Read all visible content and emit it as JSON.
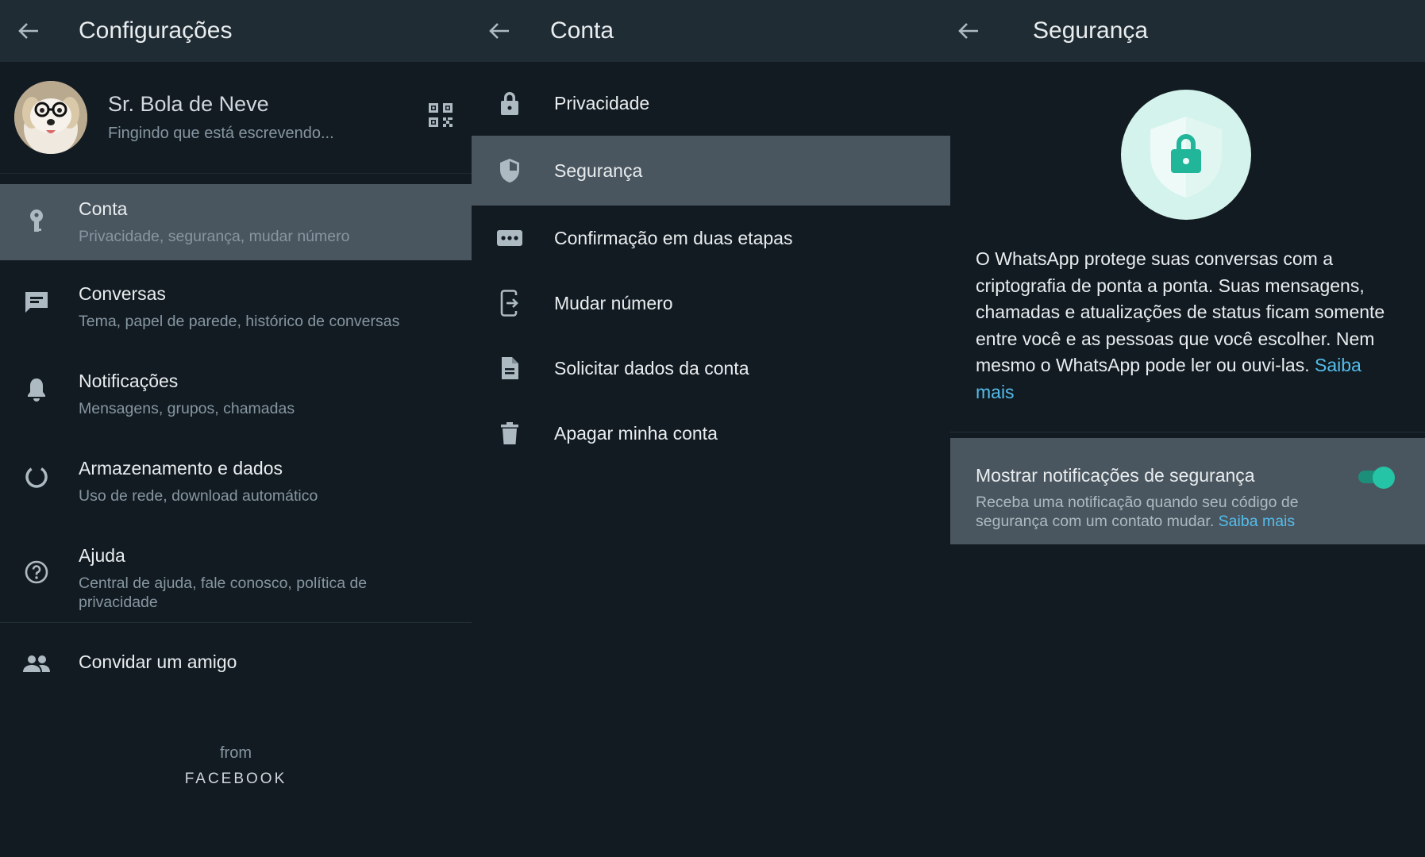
{
  "colors": {
    "background": "#121b22",
    "topbar": "#1f2c34",
    "selected_row": "#4a565f",
    "accent": "#25c4a6",
    "link": "#53bdeb"
  },
  "settings": {
    "title": "Configurações",
    "profile": {
      "name": "Sr. Bola de Neve",
      "status": "Fingindo que está escrevendo..."
    },
    "items": [
      {
        "icon": "key-icon",
        "label": "Conta",
        "sub": "Privacidade, segurança, mudar número"
      },
      {
        "icon": "chat-icon",
        "label": "Conversas",
        "sub": "Tema, papel de parede, histórico de conversas"
      },
      {
        "icon": "bell-icon",
        "label": "Notificações",
        "sub": "Mensagens, grupos, chamadas"
      },
      {
        "icon": "data-usage-icon",
        "label": "Armazenamento e dados",
        "sub": "Uso de rede, download automático"
      },
      {
        "icon": "help-icon",
        "label": "Ajuda",
        "sub": "Central de ajuda, fale conosco, política de privacidade"
      }
    ],
    "invite": {
      "icon": "people-icon",
      "label": "Convidar um amigo"
    },
    "footer": {
      "from": "from",
      "brand": "FACEBOOK"
    }
  },
  "account": {
    "title": "Conta",
    "items": [
      {
        "icon": "lock-icon",
        "label": "Privacidade"
      },
      {
        "icon": "shield-icon",
        "label": "Segurança"
      },
      {
        "icon": "dots-icon",
        "label": "Confirmação em duas etapas"
      },
      {
        "icon": "phone-change-icon",
        "label": "Mudar número"
      },
      {
        "icon": "document-icon",
        "label": "Solicitar dados da conta"
      },
      {
        "icon": "trash-icon",
        "label": "Apagar minha conta"
      }
    ]
  },
  "security": {
    "title": "Segurança",
    "description": "O WhatsApp protege suas conversas com a criptografia de ponta a ponta. Suas mensagens, chamadas e atualizações de status ficam somente entre você e as pessoas que você escolher. Nem mesmo o WhatsApp pode ler ou ouvi-las.",
    "learn_more": "Saiba mais",
    "notifications": {
      "title": "Mostrar notificações de segurança",
      "subtitle": "Receba uma notificação quando seu código de segurança com um contato mudar.",
      "learn_more": "Saiba mais",
      "enabled": true
    }
  }
}
